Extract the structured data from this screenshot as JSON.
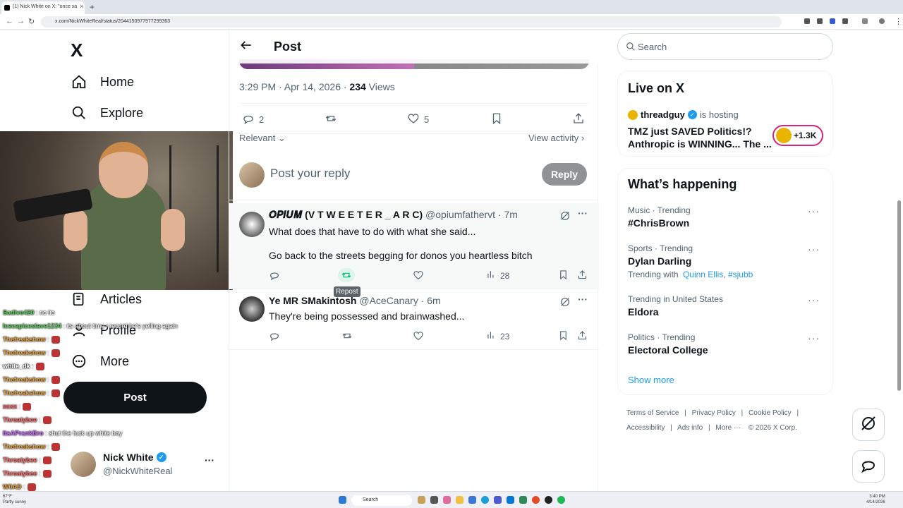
{
  "browser": {
    "tab_title": "(1) Nick White on X: \"once sa",
    "url": "x.com/NickWhiteReal/status/2044150977977299363",
    "tab_close": "×",
    "tab_add": "+"
  },
  "sidebar": {
    "logo": "X",
    "items": [
      {
        "label": "Home",
        "icon": "home-icon"
      },
      {
        "label": "Explore",
        "icon": "search-icon"
      },
      {
        "label": "Articles",
        "icon": "articles-icon"
      },
      {
        "label": "Profile",
        "icon": "profile-icon"
      },
      {
        "label": "More",
        "icon": "more-circle-icon"
      }
    ],
    "post_label": "Post",
    "profile": {
      "name": "Nick White",
      "handle": "@NickWhiteReal",
      "more": "···"
    }
  },
  "chat": [
    {
      "user": "Sadivo420",
      "msg": ": no lie",
      "color": "#5fd15f"
    },
    {
      "user": "Icecapiceslave1234",
      "msg": ": its about time i record he's yelling again",
      "color": "#5fd15f"
    },
    {
      "user": "Thefreakshow",
      "msg": ":",
      "color": "#e8a33c"
    },
    {
      "user": "Thefreakshow",
      "msg": ":",
      "color": "#e8a33c"
    },
    {
      "user": "white_dk",
      "msg": ":",
      "color": "#ffffff"
    },
    {
      "user": "Thefreakshow",
      "msg": ":",
      "color": "#e8a33c"
    },
    {
      "user": "Thefreakshow",
      "msg": ":",
      "color": "#e8a33c"
    },
    {
      "user": "xcxx",
      "msg": ":",
      "color": "#ff5a5a"
    },
    {
      "user": "Throatybee",
      "msg": ":",
      "color": "#ff6b6b"
    },
    {
      "user": "ItsAPrankBro",
      "msg": ": shut the fuck up white boy",
      "color": "#c86bff"
    },
    {
      "user": "Thefreakshow",
      "msg": ":",
      "color": "#e8a33c"
    },
    {
      "user": "Throatybee",
      "msg": ":",
      "color": "#ff6b6b"
    },
    {
      "user": "Throatybee",
      "msg": ":",
      "color": "#ff6b6b"
    },
    {
      "user": "W0AD",
      "msg": ":",
      "color": "#e8a33c"
    }
  ],
  "post": {
    "header_title": "Post",
    "timestamp": "3:29 PM · Apr 14, 2026 · ",
    "views_count": "234",
    "views_label": " Views",
    "replies": "2",
    "likes": "5",
    "sort_label": "Relevant",
    "view_activity": "View activity",
    "reply_placeholder": "Post your reply",
    "reply_button": "Reply"
  },
  "replies": [
    {
      "name": "𝑶𝑷𝑰𝑼𝑴 (V T W E E T E R _ A R C)",
      "handle": "@opiumfathervt",
      "time": " · 7m",
      "line1": "What does that have to do with what she said...",
      "line2": "Go back to the streets begging for donos you heartless bitch",
      "views": "28"
    },
    {
      "name": "Ye MR SMakintosh",
      "handle": "@AceCanary",
      "time": " · 6m",
      "line1": "They're being possessed and brainwashed...",
      "views": "23"
    }
  ],
  "tooltip": "Repost",
  "right": {
    "search_placeholder": "Search",
    "live": {
      "title": "Live on X",
      "host": "threadguy",
      "hosting": "is hosting",
      "line1": "TMZ just SAVED Politics!?",
      "line2": "Anthropic is WINNING... The ...",
      "listeners": "+1.3K"
    },
    "happening": {
      "title": "What’s happening",
      "trends": [
        {
          "category": "Music · Trending",
          "name": "#ChrisBrown"
        },
        {
          "category": "Sports · Trending",
          "name": "Dylan Darling",
          "with_label": "Trending with",
          "with1": "Quinn Ellis",
          "with2": "#sjubb"
        },
        {
          "category": "Trending in United States",
          "name": "Eldora"
        },
        {
          "category": "Politics · Trending",
          "name": "Electoral College"
        }
      ],
      "show_more": "Show more"
    },
    "footer": {
      "terms": "Terms of Service",
      "privacy": "Privacy Policy",
      "cookie": "Cookie Policy",
      "accessibility": "Accessibility",
      "ads": "Ads info",
      "more": "More ···",
      "copyright": "© 2026 X Corp."
    }
  },
  "taskbar": {
    "weather_temp": "67°F",
    "weather_desc": "Partly sunny",
    "search": "Search",
    "time": "3:40 PM",
    "date": "4/14/2026"
  },
  "colors": {
    "accent": "#1d9bf0",
    "repost_green": "#00ba7c",
    "live_pink": "#d6247a"
  }
}
